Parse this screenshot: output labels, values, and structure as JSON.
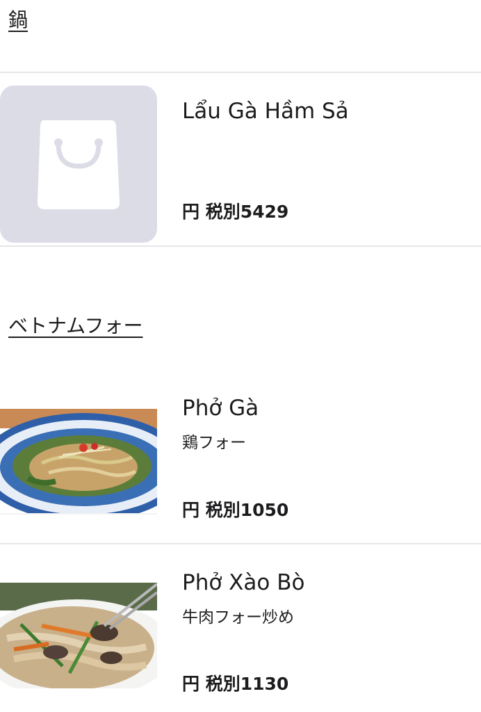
{
  "sections": [
    {
      "title": "鍋",
      "items": [
        {
          "name": "Lẩu Gà Hầm Sả",
          "description": "",
          "price": "円 税別5429",
          "image": "shopping-bag-placeholder-icon"
        }
      ]
    },
    {
      "title": "ベトナムフォー",
      "items": [
        {
          "name": "Phở Gà",
          "description": "鶏フォー",
          "price": "円 税別1050",
          "image": "chicken-pho-photo"
        },
        {
          "name": "Phở Xào Bò",
          "description": "牛肉フォー炒め",
          "price": "円 税別1130",
          "image": "stir-fried-beef-pho-photo"
        }
      ]
    }
  ],
  "colors": {
    "placeholder_bg": "#dcdce6",
    "divider": "#e6e6e9",
    "text": "#1c1c1e"
  }
}
